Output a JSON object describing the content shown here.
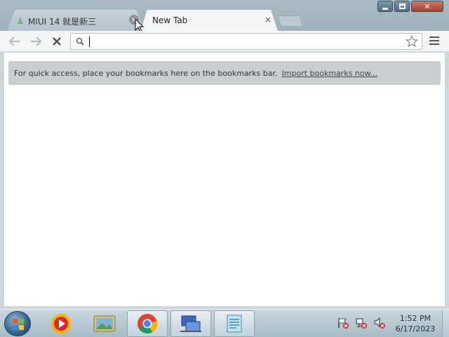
{
  "browser": {
    "tabs": [
      {
        "title": "MIUI 14 就是新三",
        "active": false
      },
      {
        "title": "New Tab",
        "active": true
      }
    ],
    "tab_close_glyph": "×",
    "omnibox": {
      "value": "",
      "placeholder": ""
    },
    "bookmarks_bar": {
      "message": "For quick access, place your bookmarks here on the bookmarks bar.",
      "link": "Import bookmarks now..."
    },
    "icons": {
      "back": "back-arrow-icon",
      "forward": "forward-arrow-icon",
      "stop": "stop-icon",
      "search": "search-icon",
      "star": "star-icon",
      "menu": "menu-icon"
    }
  },
  "window_controls": {
    "minimize": "minimize-icon",
    "maximize": "maximize-icon",
    "close": "close-icon"
  },
  "taskbar": {
    "clock_time": "1:52 PM",
    "clock_date": "6/17/2023",
    "pinned_items": [
      "media-player-icon",
      "image-viewer-icon",
      "chrome-icon",
      "network-icon",
      "notepad-icon"
    ]
  },
  "colors": {
    "titlebar": "#a9bcc6",
    "toolbar": "#f4f5f6",
    "bookmark_bar": "#c9ced1",
    "close_button": "#a9402e"
  }
}
